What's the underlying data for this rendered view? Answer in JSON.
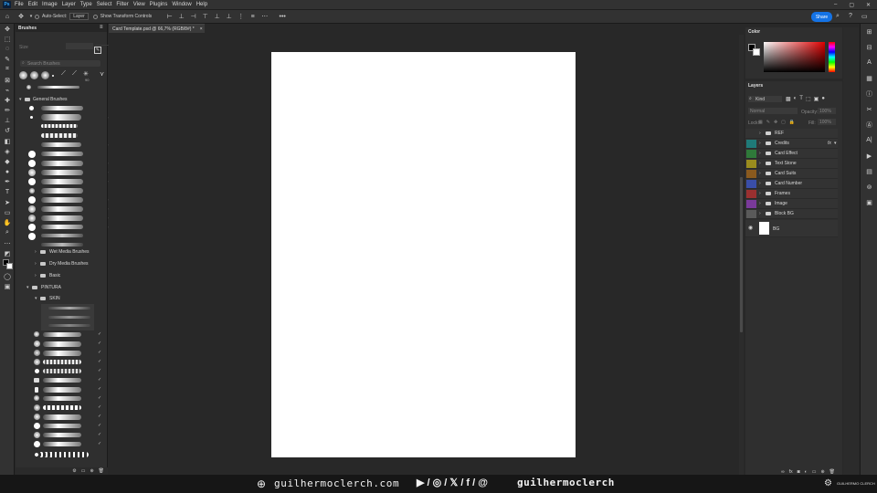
{
  "app": {
    "logo": "Ps"
  },
  "menu": [
    "File",
    "Edit",
    "Image",
    "Layer",
    "Type",
    "Select",
    "Filter",
    "View",
    "Plugins",
    "Window",
    "Help"
  ],
  "options": {
    "auto_select_label": "Auto-Select:",
    "auto_select_value": "Layer",
    "transform_label": "Show Transform Controls",
    "more": "•••"
  },
  "share_label": "Share",
  "document": {
    "tab_title": "Card Template.psd @ 66,7% (RGB/8#) *",
    "close": "×"
  },
  "brushes": {
    "title": "Brushes",
    "size_label": "Size",
    "search_placeholder": "Search Brushes",
    "groups": [
      {
        "name": "General Brushes"
      },
      {
        "name": "Wet Media Brushes"
      },
      {
        "name": "Dry Media Brushes"
      },
      {
        "name": "Basic"
      },
      {
        "name": "PINTURA"
      },
      {
        "name": "SKIN"
      }
    ],
    "preset_number": "90"
  },
  "color_panel": {
    "title": "Color"
  },
  "layers": {
    "title": "Layers",
    "kind": "Kind",
    "blend": "Normal",
    "opacity_label": "Opacity:",
    "opacity": "100%",
    "lock_label": "Lock:",
    "fill_label": "Fill:",
    "fill": "100%",
    "fx": "fx",
    "items": [
      {
        "name": "REF",
        "color": ""
      },
      {
        "name": "Credits",
        "color": "#1f7a78"
      },
      {
        "name": "Card Effect",
        "color": "#2f7a3a"
      },
      {
        "name": "Text Stone",
        "color": "#9a8c1e"
      },
      {
        "name": "Card Suits",
        "color": "#8a5a1e"
      },
      {
        "name": "Card Number",
        "color": "#3a4ea8"
      },
      {
        "name": "Frames",
        "color": "#9a3030"
      },
      {
        "name": "Image",
        "color": "#7a3a9a"
      },
      {
        "name": "Block BG",
        "color": "#5a5a5a"
      },
      {
        "name": "BG",
        "color": "#ffffff"
      }
    ]
  },
  "footer": {
    "site": "guilhermoclerch.com",
    "social": "▶ / ◎ / 𝕏 / f / @",
    "handle": "guilhermoclerch",
    "brand": "GUILHERMO CLERCH"
  },
  "colors": {
    "accent": "#1473e6",
    "canvas": "#ffffff",
    "panel": "#2f2f2f"
  }
}
